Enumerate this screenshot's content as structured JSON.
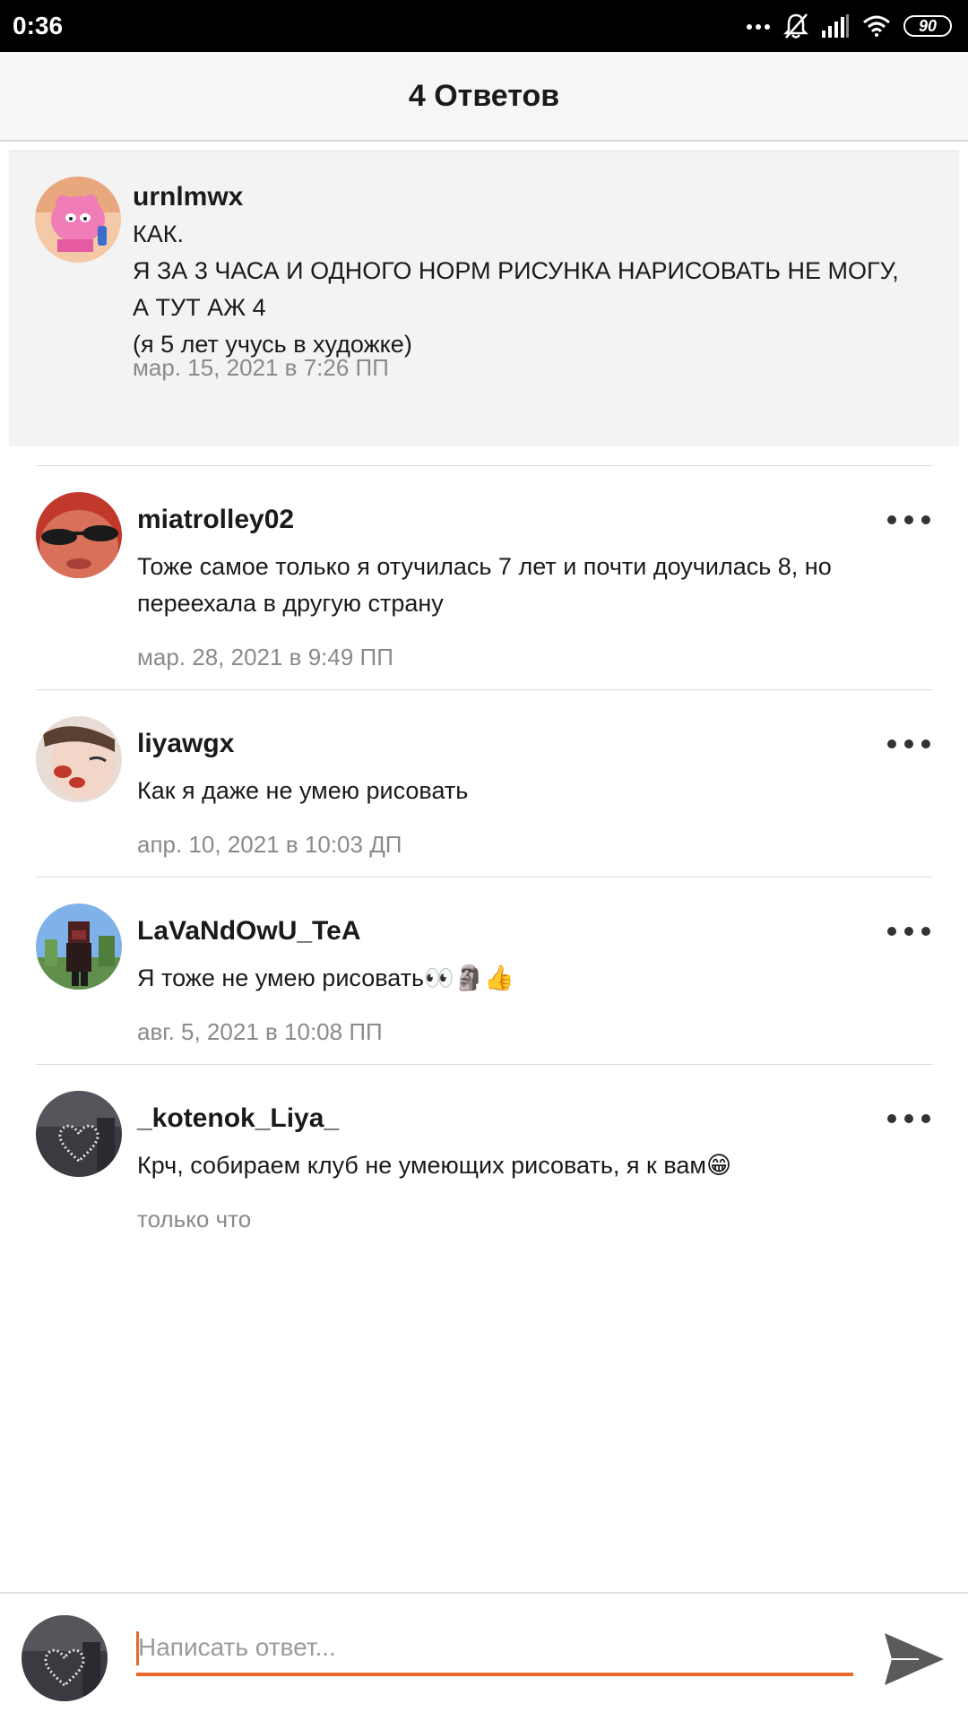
{
  "status_bar": {
    "time": "0:36",
    "battery": "90",
    "icons": [
      "more-dots-icon",
      "bell-off-icon",
      "signal-icon",
      "wifi-icon",
      "battery-icon"
    ]
  },
  "header": {
    "title": "4 Ответов"
  },
  "root_comment": {
    "author": "urnlmwx",
    "text_lines": [
      "КАК.",
      "Я ЗА 3 ЧАСА И ОДНОГО НОРМ РИСУНКА НАРИСОВАТЬ НЕ МОГУ,",
      "А ТУТ АЖ 4",
      "(я 5 лет учусь в художке)"
    ],
    "timestamp": "мар. 15, 2021 в 7:26 ПП"
  },
  "replies": [
    {
      "author": "miatrolley02",
      "text_lines": [
        "Тоже самое только я отучилась 7 лет  и почти доучилась 8, но",
        "переехала в другую страну"
      ],
      "timestamp": "мар. 28, 2021 в 9:49 ПП"
    },
    {
      "author": "liyawgx",
      "text_lines": [
        "Как я даже не умею рисовать"
      ],
      "timestamp": "апр. 10, 2021 в 10:03 ДП"
    },
    {
      "author": "LaVaNdOwU_TeA",
      "text_lines": [
        "Я тоже не умею рисовать👀🗿👍"
      ],
      "timestamp": "авг. 5, 2021 в 10:08 ПП"
    },
    {
      "author": "_kotenok_Liya_",
      "text_lines": [
        "Крч, собираем клуб не умеющих рисовать, я к вам😁"
      ],
      "timestamp": "только что"
    }
  ],
  "reply_bar": {
    "placeholder": "Написать ответ...",
    "value": ""
  },
  "colors": {
    "accent": "#e8692a",
    "root_background": "#f3f3f4",
    "header_background": "#f6f6f6",
    "timestamp": "#8a8a8a"
  }
}
